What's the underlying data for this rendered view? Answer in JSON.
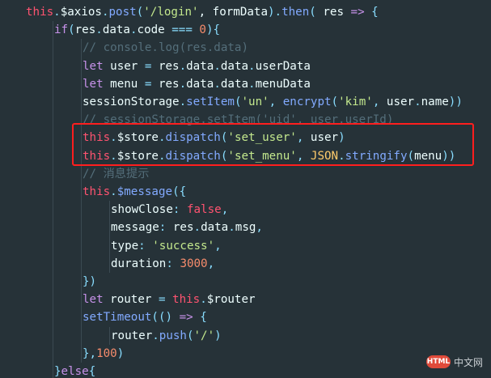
{
  "lines": [
    {
      "indent": 0,
      "tokens": [
        [
          "this",
          "this"
        ],
        [
          ".",
          "op"
        ],
        [
          "$axios",
          "id"
        ],
        [
          ".",
          "op"
        ],
        [
          "post",
          "fn"
        ],
        [
          "(",
          "op"
        ],
        [
          "'/login'",
          "str"
        ],
        [
          ", formData",
          "id"
        ],
        [
          ")",
          "op"
        ],
        [
          ".",
          "op"
        ],
        [
          "then",
          "fn"
        ],
        [
          "( ",
          "op"
        ],
        [
          "res",
          "id"
        ],
        [
          " => ",
          "kw"
        ],
        [
          "{",
          "op"
        ]
      ]
    },
    {
      "indent": 1,
      "tokens": [
        [
          "if",
          "kw"
        ],
        [
          "(",
          "op"
        ],
        [
          "res",
          "id"
        ],
        [
          ".",
          "op"
        ],
        [
          "data",
          "id"
        ],
        [
          ".",
          "op"
        ],
        [
          "code",
          "id"
        ],
        [
          " === ",
          "op"
        ],
        [
          "0",
          "num"
        ],
        [
          "){",
          "op"
        ]
      ]
    },
    {
      "indent": 2,
      "tokens": [
        [
          "// console.log(res.data)",
          "cmt"
        ]
      ]
    },
    {
      "indent": 2,
      "tokens": [
        [
          "let ",
          "kw"
        ],
        [
          "user",
          "id"
        ],
        [
          " = ",
          "op"
        ],
        [
          "res",
          "id"
        ],
        [
          ".",
          "op"
        ],
        [
          "data",
          "id"
        ],
        [
          ".",
          "op"
        ],
        [
          "data",
          "id"
        ],
        [
          ".",
          "op"
        ],
        [
          "userData",
          "id"
        ]
      ]
    },
    {
      "indent": 2,
      "tokens": [
        [
          "let ",
          "kw"
        ],
        [
          "menu",
          "id"
        ],
        [
          " = ",
          "op"
        ],
        [
          "res",
          "id"
        ],
        [
          ".",
          "op"
        ],
        [
          "data",
          "id"
        ],
        [
          ".",
          "op"
        ],
        [
          "data",
          "id"
        ],
        [
          ".",
          "op"
        ],
        [
          "menuData",
          "id"
        ]
      ]
    },
    {
      "indent": 2,
      "tokens": [
        [
          "sessionStorage",
          "id"
        ],
        [
          ".",
          "op"
        ],
        [
          "setItem",
          "fn"
        ],
        [
          "(",
          "op"
        ],
        [
          "'un'",
          "str"
        ],
        [
          ", ",
          "op"
        ],
        [
          "encrypt",
          "fn"
        ],
        [
          "(",
          "op"
        ],
        [
          "'kim'",
          "str"
        ],
        [
          ", ",
          "op"
        ],
        [
          "user",
          "id"
        ],
        [
          ".",
          "op"
        ],
        [
          "name",
          "id"
        ],
        [
          "))",
          "op"
        ]
      ]
    },
    {
      "indent": 2,
      "tokens": [
        [
          "// sessionStorage.setItem('uid', user.userId)",
          "cmt"
        ]
      ]
    },
    {
      "indent": 2,
      "tokens": [
        [
          "this",
          "this"
        ],
        [
          ".",
          "op"
        ],
        [
          "$store",
          "id"
        ],
        [
          ".",
          "op"
        ],
        [
          "dispatch",
          "fn"
        ],
        [
          "(",
          "op"
        ],
        [
          "'set_user'",
          "str"
        ],
        [
          ", ",
          "op"
        ],
        [
          "user",
          "id"
        ],
        [
          ")",
          "op"
        ]
      ]
    },
    {
      "indent": 2,
      "tokens": [
        [
          "this",
          "this"
        ],
        [
          ".",
          "op"
        ],
        [
          "$store",
          "id"
        ],
        [
          ".",
          "op"
        ],
        [
          "dispatch",
          "fn"
        ],
        [
          "(",
          "op"
        ],
        [
          "'set_menu'",
          "str"
        ],
        [
          ", ",
          "op"
        ],
        [
          "JSON",
          "bi"
        ],
        [
          ".",
          "op"
        ],
        [
          "stringify",
          "fn"
        ],
        [
          "(",
          "op"
        ],
        [
          "menu",
          "id"
        ],
        [
          "))",
          "op"
        ]
      ]
    },
    {
      "indent": 2,
      "tokens": [
        [
          "// 消息提示",
          "cmt"
        ]
      ]
    },
    {
      "indent": 2,
      "tokens": [
        [
          "this",
          "this"
        ],
        [
          ".",
          "op"
        ],
        [
          "$message",
          "fn"
        ],
        [
          "({",
          "op"
        ]
      ]
    },
    {
      "indent": 3,
      "tokens": [
        [
          "showClose",
          "key"
        ],
        [
          ": ",
          "op"
        ],
        [
          "false",
          "bool"
        ],
        [
          ",",
          "op"
        ]
      ]
    },
    {
      "indent": 3,
      "tokens": [
        [
          "message",
          "key"
        ],
        [
          ": ",
          "op"
        ],
        [
          "res",
          "id"
        ],
        [
          ".",
          "op"
        ],
        [
          "data",
          "id"
        ],
        [
          ".",
          "op"
        ],
        [
          "msg",
          "id"
        ],
        [
          ",",
          "op"
        ]
      ]
    },
    {
      "indent": 3,
      "tokens": [
        [
          "type",
          "key"
        ],
        [
          ": ",
          "op"
        ],
        [
          "'success'",
          "str"
        ],
        [
          ",",
          "op"
        ]
      ]
    },
    {
      "indent": 3,
      "tokens": [
        [
          "duration",
          "key"
        ],
        [
          ": ",
          "op"
        ],
        [
          "3000",
          "num"
        ],
        [
          ",",
          "op"
        ]
      ]
    },
    {
      "indent": 2,
      "tokens": [
        [
          "})",
          "op"
        ]
      ]
    },
    {
      "indent": 2,
      "tokens": [
        [
          "let ",
          "kw"
        ],
        [
          "router",
          "id"
        ],
        [
          " = ",
          "op"
        ],
        [
          "this",
          "this"
        ],
        [
          ".",
          "op"
        ],
        [
          "$router",
          "id"
        ]
      ]
    },
    {
      "indent": 2,
      "tokens": [
        [
          "setTimeout",
          "fn"
        ],
        [
          "(",
          "op"
        ],
        [
          "()",
          "op"
        ],
        [
          " => ",
          "kw"
        ],
        [
          "{",
          "op"
        ]
      ]
    },
    {
      "indent": 3,
      "tokens": [
        [
          "router",
          "id"
        ],
        [
          ".",
          "op"
        ],
        [
          "push",
          "fn"
        ],
        [
          "(",
          "op"
        ],
        [
          "'/'",
          "str"
        ],
        [
          ")",
          "op"
        ]
      ]
    },
    {
      "indent": 2,
      "tokens": [
        [
          "},",
          "op"
        ],
        [
          "100",
          "num"
        ],
        [
          ")",
          "op"
        ]
      ]
    },
    {
      "indent": 1,
      "tokens": [
        [
          "}",
          "op"
        ],
        [
          "else",
          "kw"
        ],
        [
          "{",
          "op"
        ]
      ]
    }
  ],
  "highlight": {
    "from_line": 7,
    "to_line": 8
  },
  "watermark": {
    "badge": "HTML",
    "text": "中文网"
  },
  "colors": {
    "background": "#263238",
    "highlight_border": "#ff1e1e"
  }
}
